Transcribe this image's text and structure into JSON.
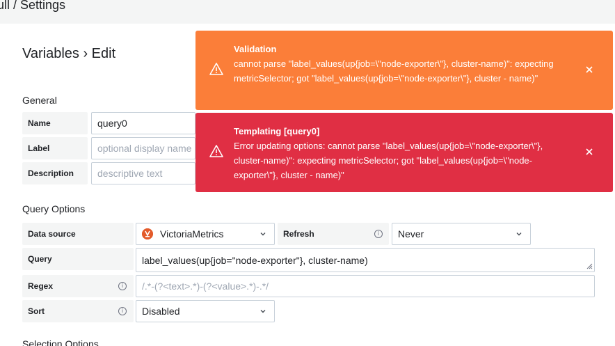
{
  "breadcrumb": "ull / Settings",
  "page_title": "Variables › Edit",
  "general": {
    "title": "General",
    "name_label": "Name",
    "name_value": "query0",
    "label_label": "Label",
    "label_placeholder": "optional display name",
    "description_label": "Description",
    "description_placeholder": "descriptive text"
  },
  "query_options": {
    "title": "Query Options",
    "datasource_label": "Data source",
    "datasource_value": "VictoriaMetrics",
    "refresh_label": "Refresh",
    "refresh_value": "Never",
    "query_label": "Query",
    "query_value": "label_values(up{job=\"node-exporter\"}, cluster-name)",
    "regex_label": "Regex",
    "regex_placeholder": "/.*-(?<text>.*)-(?<value>.*)-.*/",
    "sort_label": "Sort",
    "sort_value": "Disabled"
  },
  "selection_options_title": "Selection Options",
  "alerts": {
    "validation": {
      "title": "Validation",
      "message": "cannot parse \"label_values(up{job=\\\"node-exporter\\\"}, cluster-name)\": expecting metricSelector; got \"label_values(up{job=\\\"node-exporter\\\"}, cluster - name)\""
    },
    "templating": {
      "title": "Templating [query0]",
      "message": "Error updating options: cannot parse \"label_values(up{job=\\\"node-exporter\\\"}, cluster-name)\": expecting metricSelector; got \"label_values(up{job=\\\"node-exporter\\\"}, cluster - name)\""
    }
  },
  "colors": {
    "warning": "#fb7e39",
    "error": "#e02f44",
    "label_bg": "#f4f5f5",
    "border": "#c7d0d9"
  },
  "icons": {
    "alert": "exclamation-triangle-icon",
    "close": "close-icon",
    "info": "info-circle-icon",
    "chevron": "chevron-down-icon",
    "datasource": "victoriametrics-logo-icon"
  }
}
